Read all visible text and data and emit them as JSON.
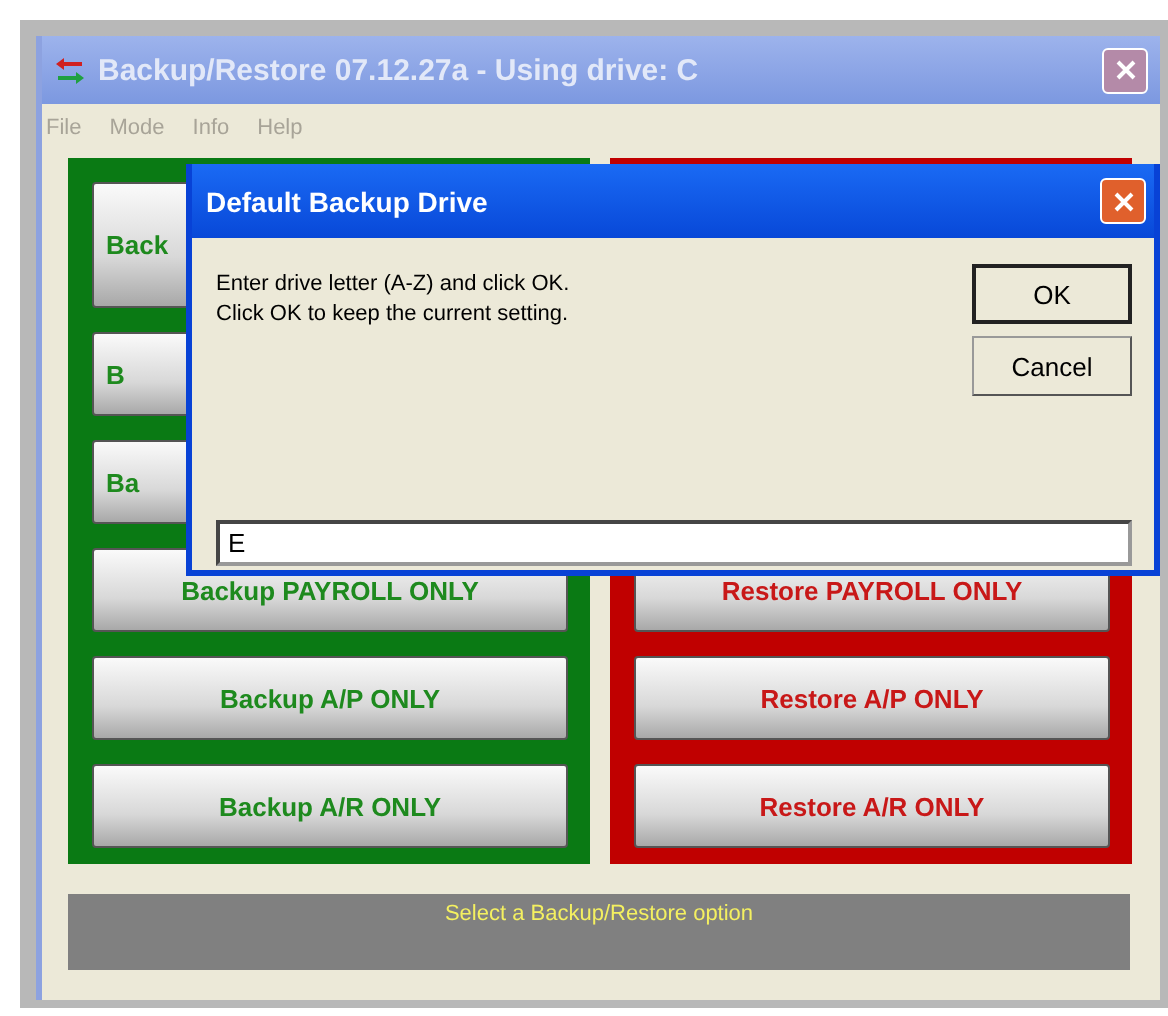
{
  "window": {
    "title": "Backup/Restore 07.12.27a - Using drive: C",
    "active": false
  },
  "menu": [
    {
      "label": "File",
      "disabled": true
    },
    {
      "label": "Mode",
      "disabled": true
    },
    {
      "label": "Info",
      "disabled": true
    },
    {
      "label": "Help",
      "disabled": true
    }
  ],
  "backup_buttons": [
    {
      "label": "Back",
      "kind": "covered"
    },
    {
      "label": "B",
      "kind": "covered"
    },
    {
      "label": "Ba",
      "kind": "covered"
    },
    {
      "label": "Backup PAYROLL ONLY",
      "kind": "full"
    },
    {
      "label": "Backup A/P ONLY",
      "kind": "full"
    },
    {
      "label": "Backup A/R ONLY",
      "kind": "full"
    }
  ],
  "restore_buttons": [
    {
      "label": "Restore PAYROLL ONLY",
      "kind": "full"
    },
    {
      "label": "Restore A/P ONLY",
      "kind": "full"
    },
    {
      "label": "Restore A/R ONLY",
      "kind": "full"
    }
  ],
  "status_bar": {
    "text": "Select a Backup/Restore option"
  },
  "dialog": {
    "title": "Default Backup Drive",
    "active": true,
    "lines": [
      "Enter drive letter (A-Z) and click OK.",
      "Click OK to keep the current setting."
    ],
    "buttons": [
      {
        "label": "OK",
        "default": true
      },
      {
        "label": "Cancel",
        "default": false
      }
    ],
    "field": {
      "value": "E"
    }
  }
}
